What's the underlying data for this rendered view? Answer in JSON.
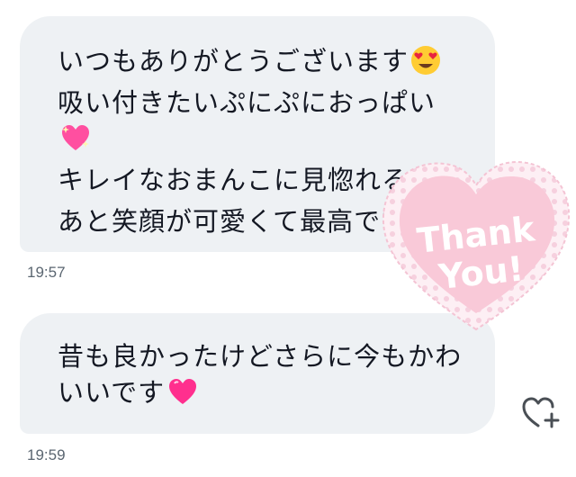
{
  "message1": {
    "line1": "いつもありがとうございます",
    "line2": "吸い付きたいぷにぷにおっぱい",
    "line4": "キレイなおまんこに見惚れる",
    "line5": "あと笑顔が可愛くて最高です‼",
    "time": "19:57",
    "emoji_line1": "heart-eyes-emoji",
    "emoji_line3": "sparkling-heart-emoji",
    "emoji_line4": "sparkling-heart-emoji"
  },
  "message2": {
    "line1": "昔も良かったけどさらに今もかわ",
    "line2": "いいです",
    "time": "19:59",
    "emoji_line2": "pink-heart-emoji"
  },
  "sticker": {
    "text_line1": "Thank",
    "text_line2": "You!",
    "color": "#f9c9d8"
  },
  "react_button": {
    "icon": "heart-plus-icon"
  }
}
